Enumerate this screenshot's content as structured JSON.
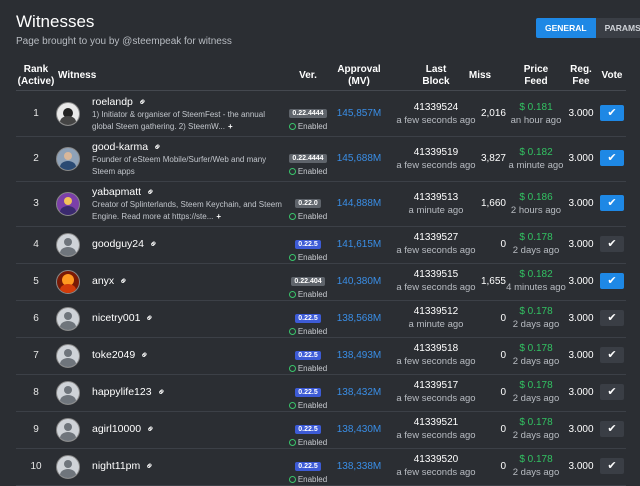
{
  "header": {
    "title": "Witnesses",
    "subtitle": "Page brought to you by @steempeak for witness",
    "tabs": [
      "GENERAL",
      "PARAMS"
    ]
  },
  "columns": {
    "rank": "Rank",
    "rank_sub": "(Active)",
    "witness": "Witness",
    "ver": "Ver.",
    "approval": "Approval",
    "approval_sub": "(MV)",
    "last": "Last",
    "last_sub": "Block",
    "miss": "Miss",
    "price": "Price",
    "price_sub": "Feed",
    "reg": "Reg.",
    "reg_sub": "Fee",
    "vote": "Vote"
  },
  "status_label": "Enabled",
  "colors": {
    "accent": "#1e88e5",
    "price": "#32c262",
    "approval": "#3a8ee6"
  },
  "rows": [
    {
      "rank": "1",
      "name": "roelandp",
      "desc1": "1) Initiator & organiser of SteemFest - the annual",
      "desc2": "global Steem gathering. 2) SteemW...",
      "ver": "0.22.4444",
      "approval": "145,857M",
      "block": "41339524",
      "block_ago": "a few seconds ago",
      "miss": "2,016",
      "price": "$ 0.181",
      "price_ago": "an hour ago",
      "fee": "3.000",
      "voted": true
    },
    {
      "rank": "2",
      "name": "good-karma",
      "desc1": "Founder of eSteem Mobile/Surfer/Web and many",
      "desc2": "Steem apps",
      "ver": "0.22.4444",
      "approval": "145,688M",
      "block": "41339519",
      "block_ago": "a few seconds ago",
      "miss": "3,827",
      "price": "$ 0.182",
      "price_ago": "a minute ago",
      "fee": "3.000",
      "voted": true
    },
    {
      "rank": "3",
      "name": "yabapmatt",
      "desc1": "Creator of Splinterlands, Steem Keychain, and Steem",
      "desc2": "Engine. Read more at https://ste...",
      "ver": "0.22.0",
      "approval": "144,888M",
      "block": "41339513",
      "block_ago": "a minute ago",
      "miss": "1,660",
      "price": "$ 0.186",
      "price_ago": "2 hours ago",
      "fee": "3.000",
      "voted": true
    },
    {
      "rank": "4",
      "name": "goodguy24",
      "ver": "0.22.5",
      "approval": "141,615M",
      "block": "41339527",
      "block_ago": "a few seconds ago",
      "miss": "0",
      "price": "$ 0.178",
      "price_ago": "2 days ago",
      "fee": "3.000",
      "voted": false
    },
    {
      "rank": "5",
      "name": "anyx",
      "ver": "0.22.404",
      "approval": "140,380M",
      "block": "41339515",
      "block_ago": "a few seconds ago",
      "miss": "1,655",
      "price": "$ 0.182",
      "price_ago": "4 minutes ago",
      "fee": "3.000",
      "voted": true
    },
    {
      "rank": "6",
      "name": "nicetry001",
      "ver": "0.22.5",
      "approval": "138,568M",
      "block": "41339512",
      "block_ago": "a minute ago",
      "miss": "0",
      "price": "$ 0.178",
      "price_ago": "2 days ago",
      "fee": "3.000",
      "voted": false
    },
    {
      "rank": "7",
      "name": "toke2049",
      "ver": "0.22.5",
      "approval": "138,493M",
      "block": "41339518",
      "block_ago": "a few seconds ago",
      "miss": "0",
      "price": "$ 0.178",
      "price_ago": "2 days ago",
      "fee": "3.000",
      "voted": false
    },
    {
      "rank": "8",
      "name": "happylife123",
      "ver": "0.22.5",
      "approval": "138,432M",
      "block": "41339517",
      "block_ago": "a few seconds ago",
      "miss": "0",
      "price": "$ 0.178",
      "price_ago": "2 days ago",
      "fee": "3.000",
      "voted": false
    },
    {
      "rank": "9",
      "name": "agirl10000",
      "ver": "0.22.5",
      "approval": "138,430M",
      "block": "41339521",
      "block_ago": "a few seconds ago",
      "miss": "0",
      "price": "$ 0.178",
      "price_ago": "2 days ago",
      "fee": "3.000",
      "voted": false
    },
    {
      "rank": "10",
      "name": "night11pm",
      "ver": "0.22.5",
      "approval": "138,338M",
      "block": "41339520",
      "block_ago": "a few seconds ago",
      "miss": "0",
      "price": "$ 0.178",
      "price_ago": "2 days ago",
      "fee": "3.000",
      "voted": false
    }
  ]
}
